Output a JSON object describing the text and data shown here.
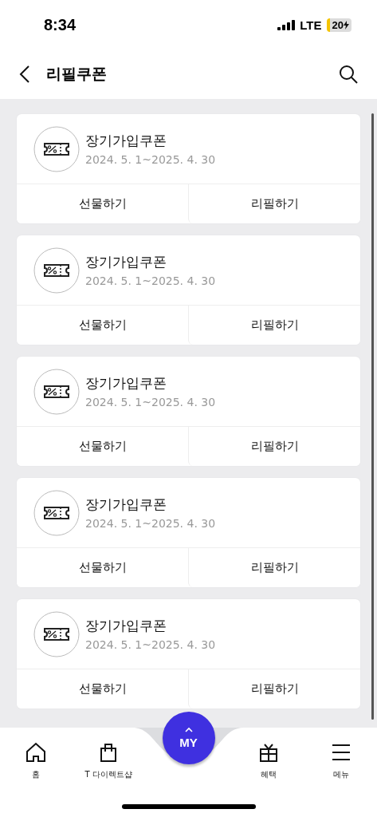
{
  "status_bar": {
    "time": "8:34",
    "network": "LTE",
    "battery": "20"
  },
  "header": {
    "title": "리필쿠폰"
  },
  "coupons": [
    {
      "name": "장기가입쿠폰",
      "period": "2024. 5. 1~2025. 4. 30",
      "actions": [
        "선물하기",
        "리필하기"
      ]
    },
    {
      "name": "장기가입쿠폰",
      "period": "2024. 5. 1~2025. 4. 30",
      "actions": [
        "선물하기",
        "리필하기"
      ]
    },
    {
      "name": "장기가입쿠폰",
      "period": "2024. 5. 1~2025. 4. 30",
      "actions": [
        "선물하기",
        "리필하기"
      ]
    },
    {
      "name": "장기가입쿠폰",
      "period": "2024. 5. 1~2025. 4. 30",
      "actions": [
        "선물하기",
        "리필하기"
      ]
    },
    {
      "name": "장기가입쿠폰",
      "period": "2024. 5. 1~2025. 4. 30",
      "actions": [
        "선물하기",
        "리필하기"
      ]
    }
  ],
  "tab_bar": {
    "items": [
      {
        "label": "홈"
      },
      {
        "label": "T 다이렉트샵"
      },
      {
        "label": "혜택"
      },
      {
        "label": "메뉴"
      }
    ],
    "center_button": {
      "label": "MY"
    }
  }
}
